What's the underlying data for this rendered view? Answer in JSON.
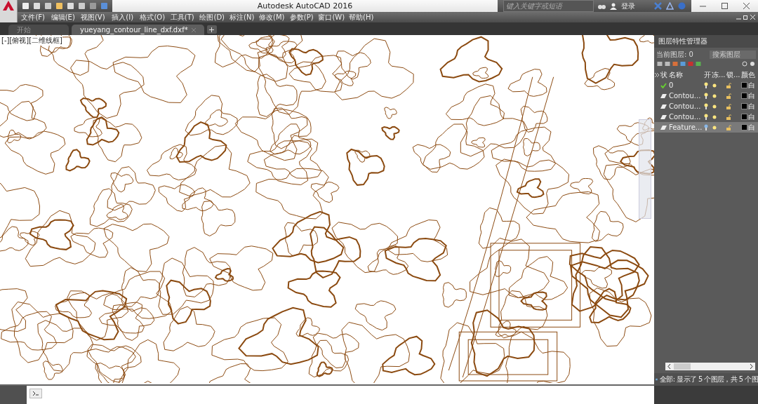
{
  "window": {
    "title": "Autodesk AutoCAD 2016",
    "search": {
      "placeholder": "键入关键字或短语"
    },
    "login": "登录"
  },
  "menu": [
    "文件(F)",
    "编辑(E)",
    "视图(V)",
    "插入(I)",
    "格式(O)",
    "工具(T)",
    "绘图(D)",
    "标注(N)",
    "修改(M)",
    "参数(P)",
    "窗口(W)",
    "帮助(H)"
  ],
  "tabs": [
    {
      "label": "开始",
      "selected": false
    },
    {
      "label": "yueyang_contour_line_dxf.dxf*",
      "selected": true
    }
  ],
  "viewport": {
    "label": "[-][俯视][二维线框]"
  },
  "layer_panel": {
    "title": "图层特性管理器",
    "current_layer": "当前图层: 0",
    "search": {
      "placeholder": "搜索图层"
    },
    "columns": [
      "状",
      "名称",
      "开",
      "冻...",
      "锁...",
      "颜色"
    ],
    "rows": [
      {
        "name": "0",
        "current": true,
        "selected": false,
        "on": true,
        "color_name": "白"
      },
      {
        "name": "Contou...",
        "current": false,
        "selected": false,
        "on": true,
        "color_name": "白"
      },
      {
        "name": "Contou...",
        "current": false,
        "selected": false,
        "on": true,
        "color_name": "白"
      },
      {
        "name": "Contou...",
        "current": false,
        "selected": false,
        "on": true,
        "color_name": "白"
      },
      {
        "name": "Feature...",
        "current": false,
        "selected": true,
        "on": false,
        "color_name": "白"
      }
    ],
    "status": "全部: 显示了 5 个图层，共 5 个图"
  }
}
